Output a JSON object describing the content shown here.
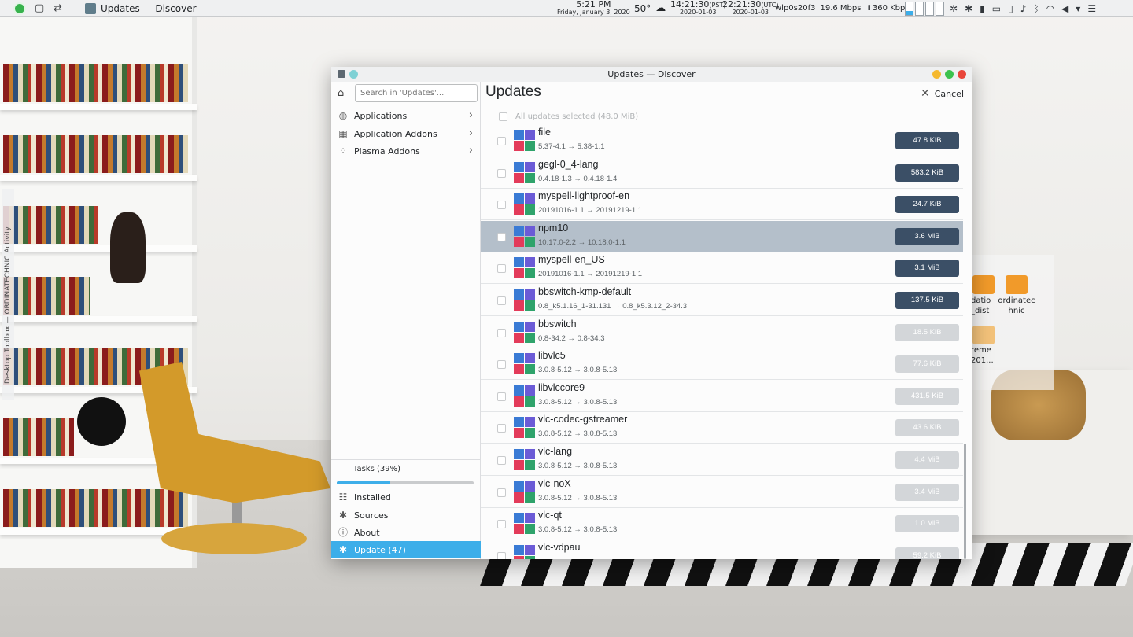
{
  "panel": {
    "taskbar_title": "Updates — Discover",
    "time_local": "5:21 PM",
    "date_local": "Friday, January 3, 2020",
    "temperature": "50°",
    "time_pst": "14:21:30",
    "tz_pst": "(PST)",
    "date_pst": "2020-01-03",
    "time_utc": "22:21:30",
    "tz_utc": "(UTC)",
    "date_utc": "2020-01-03",
    "net_iface": "wlp0s20f3",
    "net_down": "19.6 Mbps",
    "net_up": "360 Kbps"
  },
  "toolbox": {
    "label": "Desktop Toolbox — ORDINATECHNIC Activity"
  },
  "desktop": {
    "icon1": "ordinatec hnic",
    "icon2_partial": "datio _dist",
    "icon3_partial": "reme 201..."
  },
  "window": {
    "title": "Updates — Discover"
  },
  "sidebar": {
    "search_placeholder": "Search in 'Updates'...",
    "categories": [
      {
        "label": "Applications",
        "icon": "applications-icon"
      },
      {
        "label": "Application Addons",
        "icon": "addons-grid-icon"
      },
      {
        "label": "Plasma Addons",
        "icon": "plasma-icon"
      }
    ],
    "tasks_label": "Tasks (39%)",
    "tasks_progress": 0.39,
    "bottom": [
      {
        "label": "Installed",
        "icon": "list-icon"
      },
      {
        "label": "Sources",
        "icon": "gear-icon"
      },
      {
        "label": "About",
        "icon": "info-icon"
      },
      {
        "label": "Update (47)",
        "icon": "update-gear-icon"
      }
    ]
  },
  "main": {
    "title": "Updates",
    "cancel_label": "Cancel",
    "select_all_label": "All updates selected (48.0 MiB)"
  },
  "updates": [
    {
      "name": "file",
      "version": "5.37-4.1 → 5.38-1.1",
      "size": "47.8 KiB",
      "state": "dark"
    },
    {
      "name": "gegl-0_4-lang",
      "version": "0.4.18-1.3 → 0.4.18-1.4",
      "size": "583.2 KiB",
      "state": "dark"
    },
    {
      "name": "myspell-lightproof-en",
      "version": "20191016-1.1 → 20191219-1.1",
      "size": "24.7 KiB",
      "state": "dark"
    },
    {
      "name": "npm10",
      "version": "10.17.0-2.2 → 10.18.0-1.1",
      "size": "3.6 MiB",
      "state": "dark",
      "selected": true
    },
    {
      "name": "myspell-en_US",
      "version": "20191016-1.1 → 20191219-1.1",
      "size": "3.1 MiB",
      "state": "dark"
    },
    {
      "name": "bbswitch-kmp-default",
      "version": "0.8_k5.1.16_1-31.131 → 0.8_k5.3.12_2-34.3",
      "size": "137.5 KiB",
      "state": "dark"
    },
    {
      "name": "bbswitch",
      "version": "0.8-34.2 → 0.8-34.3",
      "size": "18.5 KiB",
      "state": "light"
    },
    {
      "name": "libvlc5",
      "version": "3.0.8-5.12 → 3.0.8-5.13",
      "size": "77.6 KiB",
      "state": "light"
    },
    {
      "name": "libvlccore9",
      "version": "3.0.8-5.12 → 3.0.8-5.13",
      "size": "431.5 KiB",
      "state": "light"
    },
    {
      "name": "vlc-codec-gstreamer",
      "version": "3.0.8-5.12 → 3.0.8-5.13",
      "size": "43.6 KiB",
      "state": "light"
    },
    {
      "name": "vlc-lang",
      "version": "3.0.8-5.12 → 3.0.8-5.13",
      "size": "4.4 MiB",
      "state": "light"
    },
    {
      "name": "vlc-noX",
      "version": "3.0.8-5.12 → 3.0.8-5.13",
      "size": "3.4 MiB",
      "state": "light"
    },
    {
      "name": "vlc-qt",
      "version": "3.0.8-5.12 → 3.0.8-5.13",
      "size": "1.0 MiB",
      "state": "light"
    },
    {
      "name": "vlc-vdpau",
      "version": "",
      "size": "59.2 KiB",
      "state": "light"
    }
  ],
  "colors": {
    "accent": "#3daee9",
    "selected_row": "#b4bfca",
    "size_dark": "#3b4f66",
    "size_light": "#d3d6d9"
  }
}
